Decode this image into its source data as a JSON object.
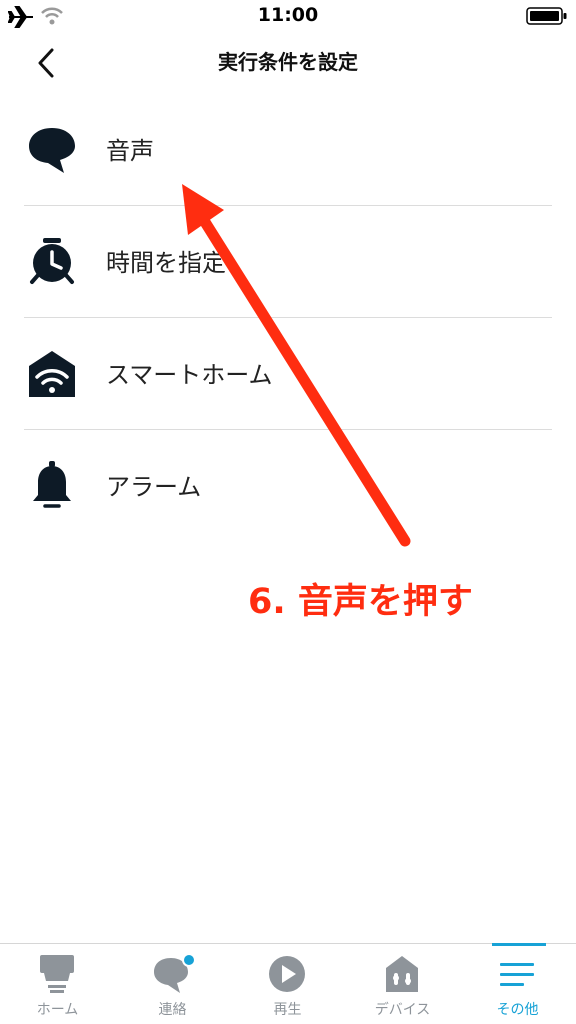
{
  "status_bar": {
    "time": "11:00",
    "icons": [
      "airplane-icon",
      "wifi-icon",
      "battery-icon"
    ]
  },
  "nav": {
    "title": "実行条件を設定",
    "back_icon": "chevron-left-icon"
  },
  "conditions": [
    {
      "label": "音声",
      "icon": "speech-bubble-icon"
    },
    {
      "label": "時間を指定",
      "icon": "alarm-clock-icon"
    },
    {
      "label": "スマートホーム",
      "icon": "smart-home-icon"
    },
    {
      "label": "アラーム",
      "icon": "bell-icon"
    }
  ],
  "annotation": {
    "text": "6. 音声を押す",
    "color": "#ff2d10"
  },
  "tabs": [
    {
      "label": "ホーム",
      "icon": "home-icon",
      "active": false
    },
    {
      "label": "連絡",
      "icon": "chat-icon",
      "active": false,
      "badge": true
    },
    {
      "label": "再生",
      "icon": "play-icon",
      "active": false
    },
    {
      "label": "デバイス",
      "icon": "devices-icon",
      "active": false
    },
    {
      "label": "その他",
      "icon": "menu-icon",
      "active": true
    }
  ],
  "colors": {
    "accent": "#17a2d6",
    "inactive": "#8e949a",
    "icon_dark": "#0d1a26"
  }
}
